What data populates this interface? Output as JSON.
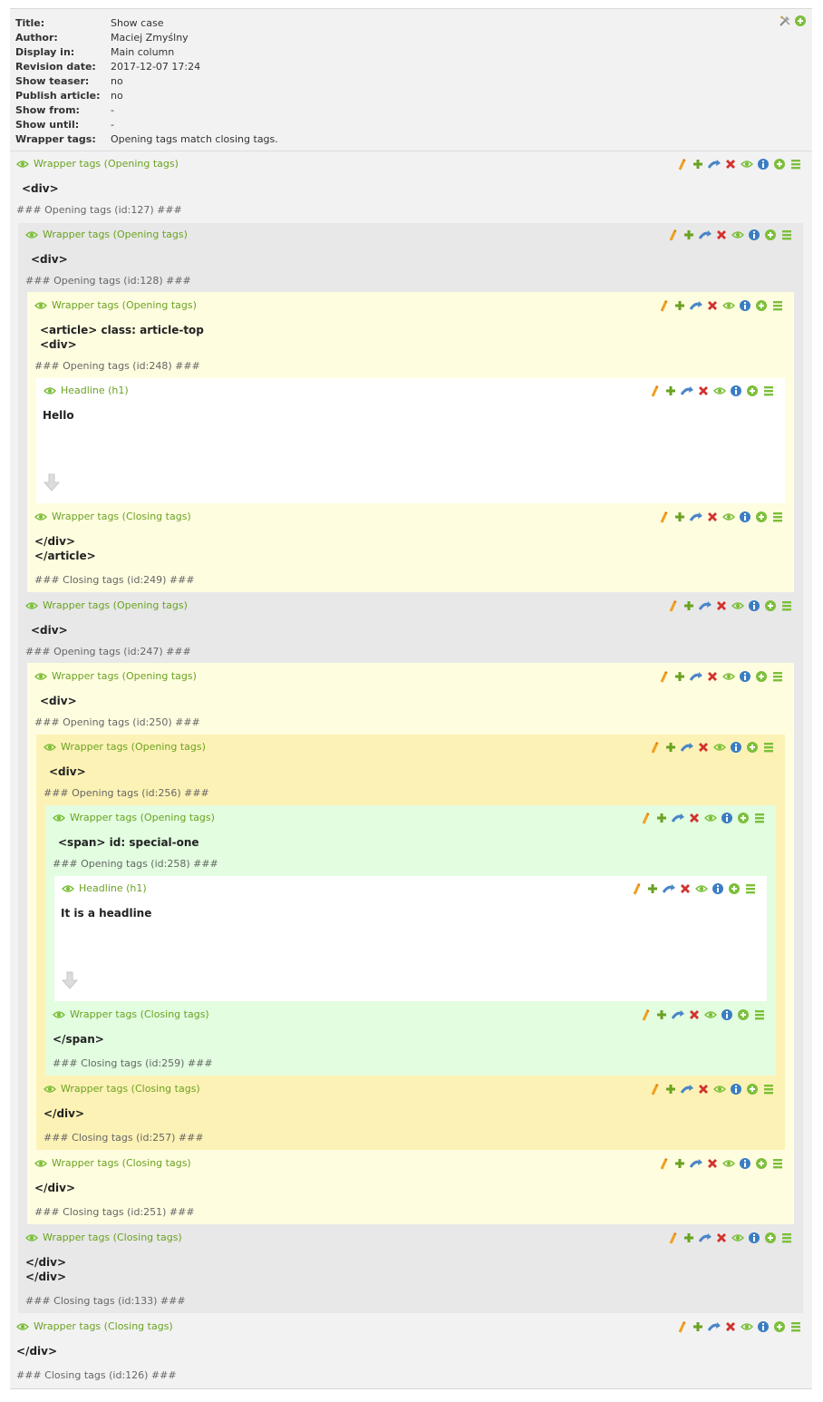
{
  "meta": {
    "rows": [
      {
        "label": "Title:",
        "value": "Show case"
      },
      {
        "label": "Author:",
        "value": "Maciej Zmyślny"
      },
      {
        "label": "Display in:",
        "value": "Main column"
      },
      {
        "label": "Revision date:",
        "value": "2017-12-07 17:24"
      },
      {
        "label": "Show teaser:",
        "value": "no"
      },
      {
        "label": "Publish article:",
        "value": "no"
      },
      {
        "label": "Show from:",
        "value": "-"
      },
      {
        "label": "Show until:",
        "value": "-"
      },
      {
        "label": "Wrapper tags:",
        "value": "Opening tags match closing tags."
      }
    ]
  },
  "blocks": [
    {
      "title": "Wrapper tags (Opening tags)",
      "lines": [
        "<div>"
      ],
      "note": "### Opening tags (id:127) ###"
    },
    {
      "title": "Wrapper tags (Opening tags)",
      "lines": [
        "<div>"
      ],
      "note": "### Opening tags (id:128) ###"
    },
    {
      "title": "Wrapper tags (Opening tags)",
      "lines": [
        "<article> class: article-top",
        "<div>"
      ],
      "note": "### Opening tags (id:248) ###"
    },
    {
      "title": "Headline (h1)",
      "lines": [
        "Hello"
      ],
      "note": ""
    },
    {
      "title": "Wrapper tags (Closing tags)",
      "lines": [
        "</div>",
        "</article>"
      ],
      "note": "### Closing tags (id:249) ###"
    },
    {
      "title": "Wrapper tags (Opening tags)",
      "lines": [
        "<div>"
      ],
      "note": "### Opening tags (id:247) ###"
    },
    {
      "title": "Wrapper tags (Opening tags)",
      "lines": [
        "<div>"
      ],
      "note": "### Opening tags (id:250) ###"
    },
    {
      "title": "Wrapper tags (Opening tags)",
      "lines": [
        "<div>"
      ],
      "note": "### Opening tags (id:256) ###"
    },
    {
      "title": "Wrapper tags (Opening tags)",
      "lines": [
        "<span> id: special-one"
      ],
      "note": "### Opening tags (id:258) ###"
    },
    {
      "title": "Headline (h1)",
      "lines": [
        "It is a headline"
      ],
      "note": ""
    },
    {
      "title": "Wrapper tags (Closing tags)",
      "lines": [
        "</span>"
      ],
      "note": "### Closing tags (id:259) ###"
    },
    {
      "title": "Wrapper tags (Closing tags)",
      "lines": [
        "</div>"
      ],
      "note": "### Closing tags (id:257) ###"
    },
    {
      "title": "Wrapper tags (Closing tags)",
      "lines": [
        "</div>"
      ],
      "note": "### Closing tags (id:251) ###"
    },
    {
      "title": "Wrapper tags (Closing tags)",
      "lines": [
        "</div>",
        "</div>"
      ],
      "note": "### Closing tags (id:133) ###"
    },
    {
      "title": "Wrapper tags (Closing tags)",
      "lines": [
        "</div>"
      ],
      "note": "### Closing tags (id:126) ###"
    }
  ],
  "toolbar_icons": [
    "edit-pencil-icon",
    "add-plus-icon",
    "move-arrow-icon",
    "delete-x-icon",
    "visibility-eye-icon",
    "info-icon",
    "add-circle-icon",
    "menu-lines-icon"
  ],
  "colors": {
    "green": "#6aa222",
    "red": "#d2322d",
    "blue": "#3b7dc4",
    "yellow_bg": "#fffde0",
    "yellow_dark_bg": "#fdf2b5",
    "green_bg": "#e2fde0",
    "grey_bg": "#e8e8e8"
  }
}
